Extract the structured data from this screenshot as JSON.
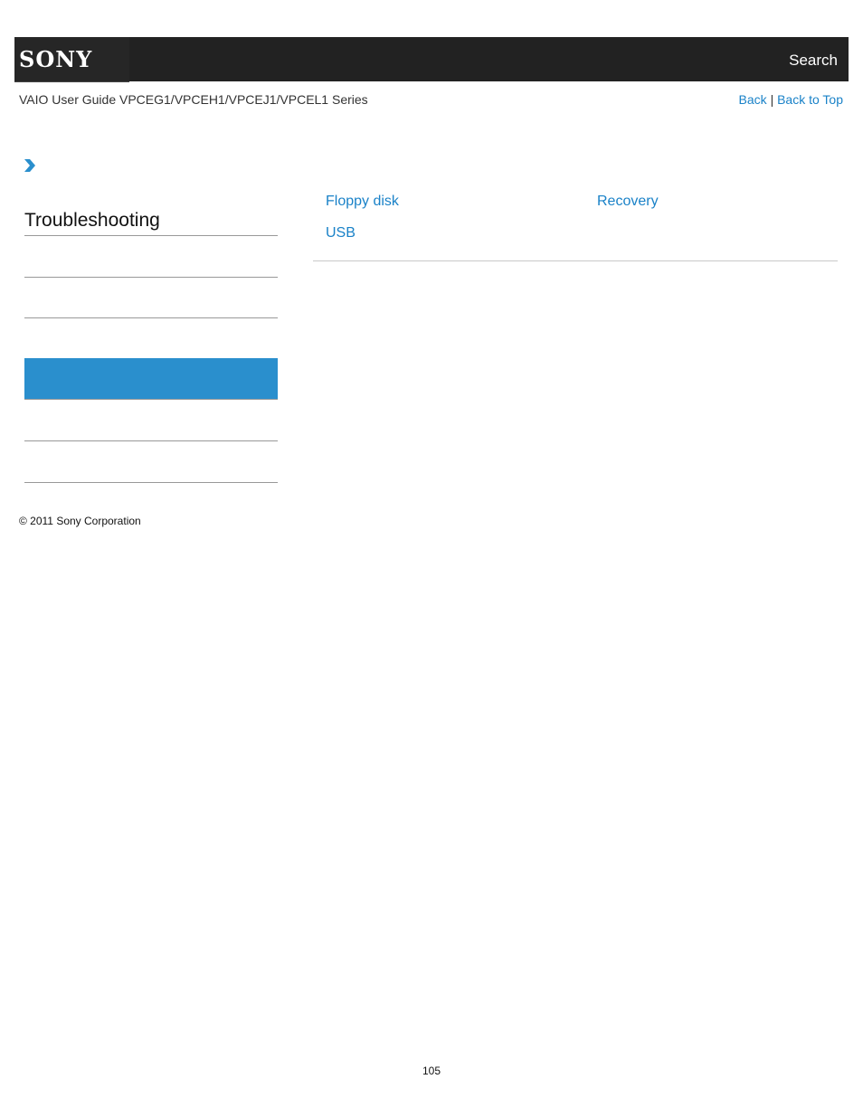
{
  "header": {
    "logo": "SONY",
    "search_label": "Search"
  },
  "subheader": {
    "guide_title": "VAIO User Guide VPCEG1/VPCEH1/VPCEJ1/VPCEL1 Series",
    "back_label": "Back",
    "separator": "|",
    "back_to_top_label": "Back to Top"
  },
  "sidebar": {
    "title": "Troubleshooting",
    "items": [
      {
        "label": "",
        "active": false
      },
      {
        "label": "",
        "active": false
      },
      {
        "label": "",
        "active": true
      },
      {
        "label": "",
        "active": false
      },
      {
        "label": "",
        "active": false
      }
    ]
  },
  "main": {
    "links": [
      {
        "label": "Floppy disk"
      },
      {
        "label": "Recovery"
      },
      {
        "label": "USB"
      }
    ]
  },
  "colors": {
    "accent": "#2a8fcd",
    "link": "#1a82c8",
    "header_bg": "#222222"
  },
  "footer": {
    "copyright": "© 2011 Sony Corporation",
    "page_number": "105"
  }
}
